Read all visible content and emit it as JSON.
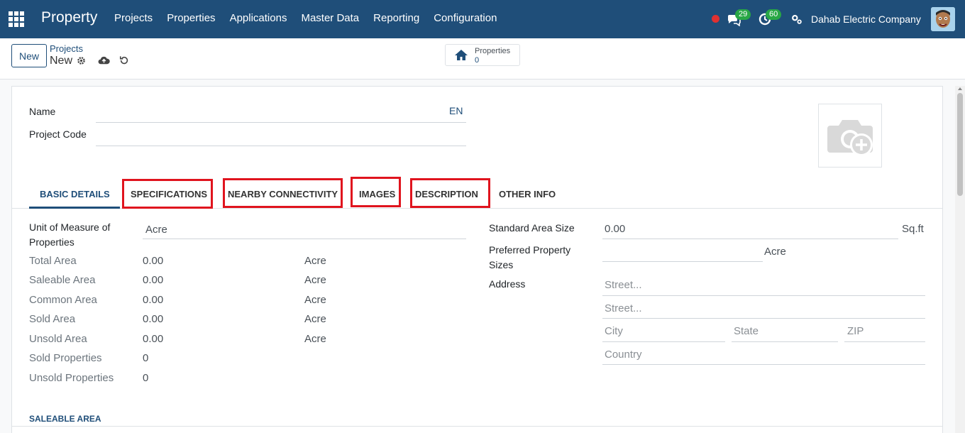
{
  "topbar": {
    "brand": "Property",
    "menu": [
      "Projects",
      "Properties",
      "Applications",
      "Master Data",
      "Reporting",
      "Configuration"
    ],
    "messages_count": "29",
    "activities_count": "60",
    "company": "Dahab Electric Company",
    "color": "#1f4e79"
  },
  "control": {
    "new_label": "New",
    "breadcrumb_parent": "Projects",
    "breadcrumb_current": "New",
    "smart_button": {
      "label": "Properties",
      "value": "0"
    }
  },
  "form": {
    "name_label": "Name",
    "lang": "EN",
    "code_label": "Project Code",
    "image_icon": "camera-add-icon"
  },
  "tabs": [
    {
      "label": "BASIC DETAILS",
      "active": true
    },
    {
      "label": "SPECIFICATIONS",
      "highlighted": true
    },
    {
      "label": "NEARBY CONNECTIVITY",
      "highlighted": true
    },
    {
      "label": "IMAGES",
      "highlighted": true
    },
    {
      "label": "DESCRIPTION",
      "highlighted": true
    },
    {
      "label": "OTHER INFO"
    }
  ],
  "basic": {
    "uom_label_1": "Unit of Measure of",
    "uom_label_2": "Properties",
    "uom_value": "Acre",
    "rows": [
      {
        "label": "Total Area",
        "value": "0.00",
        "unit": "Acre"
      },
      {
        "label": "Saleable Area",
        "value": "0.00",
        "unit": "Acre"
      },
      {
        "label": "Common Area",
        "value": "0.00",
        "unit": "Acre"
      },
      {
        "label": "Sold Area",
        "value": "0.00",
        "unit": "Acre"
      },
      {
        "label": "Unsold Area",
        "value": "0.00",
        "unit": "Acre"
      },
      {
        "label": "Sold Properties",
        "value": "0"
      },
      {
        "label": "Unsold Properties",
        "value": "0"
      }
    ],
    "std_area_label": "Standard Area Size",
    "std_area_value": "0.00",
    "std_area_unit": "Sq.ft",
    "pref_label_1": "Preferred Property",
    "pref_label_2": "Sizes",
    "pref_unit": "Acre",
    "address_label": "Address",
    "street_ph": "Street...",
    "street2_ph": "Street...",
    "city_ph": "City",
    "state_ph": "State",
    "zip_ph": "ZIP",
    "country_ph": "Country"
  },
  "section": {
    "title": "SALEABLE AREA"
  }
}
